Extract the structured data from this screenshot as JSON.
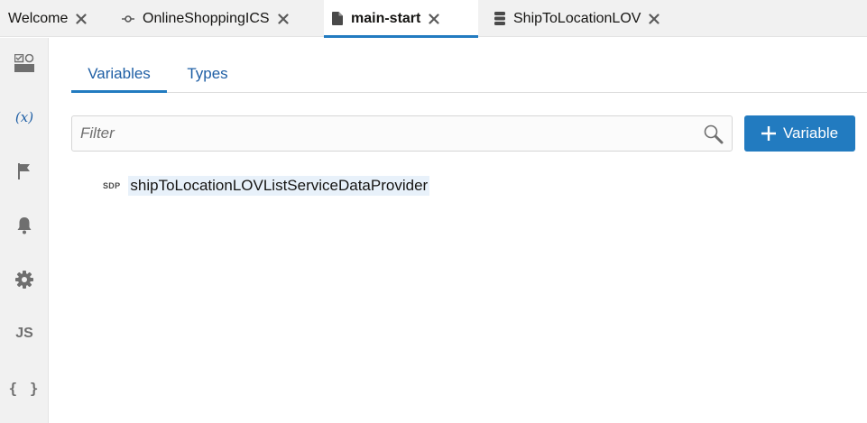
{
  "tabs": [
    {
      "label": "Welcome",
      "icon": "none",
      "active": false
    },
    {
      "label": "OnlineShoppingICS",
      "icon": "service-connection-icon",
      "active": false
    },
    {
      "label": "main-start",
      "icon": "file-icon",
      "active": true
    },
    {
      "label": "ShipToLocationLOV",
      "icon": "database-icon",
      "active": false
    }
  ],
  "rail": {
    "vars_label": "(x)",
    "js_label": "JS",
    "json_label": "{ }",
    "items": [
      "page-designer-icon",
      "variables-icon",
      "actions-flag-icon",
      "events-bell-icon",
      "settings-gear-icon",
      "js-icon",
      "json-icon"
    ]
  },
  "subtabs": {
    "variables": "Variables",
    "types": "Types"
  },
  "filter": {
    "placeholder": "Filter",
    "value": ""
  },
  "add_button": {
    "label": "Variable"
  },
  "variables": [
    {
      "badge": "SDP",
      "name": "shipToLocationLOVListServiceDataProvider"
    }
  ],
  "colors": {
    "accent": "#227bc0",
    "link": "#1f5fa5",
    "rail_bg": "#f1f1f1",
    "selection": "#e8f1fa"
  }
}
